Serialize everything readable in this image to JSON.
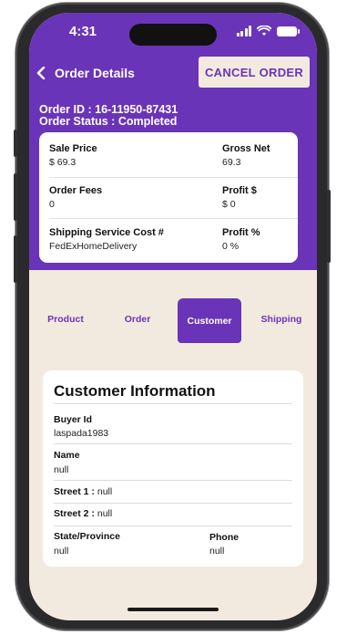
{
  "status_bar": {
    "time": "4:31"
  },
  "nav": {
    "title": "Order Details",
    "cancel_label": "CANCEL ORDER"
  },
  "order": {
    "id_line": "Order ID : 16-11950-87431",
    "status_line": "Order Status : Completed"
  },
  "summary": {
    "sale_price_label": "Sale Price",
    "sale_price_value": "$ 69.3",
    "gross_net_label": "Gross Net",
    "gross_net_value": "69.3",
    "order_fees_label": "Order Fees",
    "order_fees_value": "0",
    "profit_label": "Profit $",
    "profit_value": "$ 0",
    "shipping_cost_label": "Shipping Service Cost #",
    "shipping_cost_value": "FedExHomeDelivery",
    "profit_pct_label": "Profit %",
    "profit_pct_value": "0 %"
  },
  "tabs": [
    {
      "label": "Product"
    },
    {
      "label": "Order"
    },
    {
      "label": "Customer"
    },
    {
      "label": "Shipping"
    }
  ],
  "customer": {
    "title": "Customer Information",
    "buyer_id_label": "Buyer Id",
    "buyer_id_value": "laspada1983",
    "name_label": "Name",
    "name_value": "null",
    "street1_label": "Street 1 :",
    "street1_value": "null",
    "street2_label": "Street 2 :",
    "street2_value": "null",
    "state_label": "State/Province",
    "state_value": "null",
    "phone_label": "Phone",
    "phone_value": "null"
  },
  "colors": {
    "brand": "#6a34b8",
    "background": "#f3eadf"
  },
  "icons": [
    "back-chevron-icon",
    "wifi-icon",
    "signal-icon",
    "battery-icon"
  ]
}
